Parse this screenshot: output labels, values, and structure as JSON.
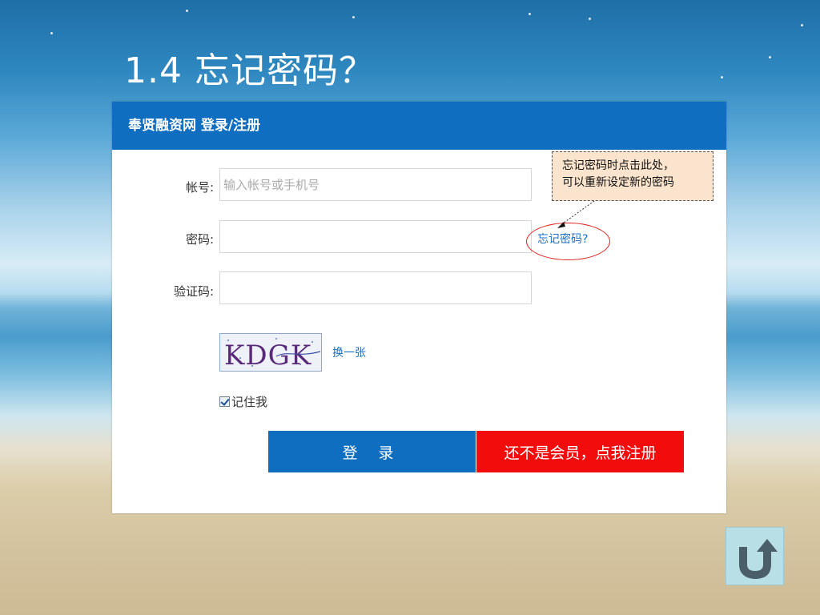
{
  "slide": {
    "title": "1.4 忘记密码？"
  },
  "site_header": {
    "title": "奉贤融资网  登录/注册"
  },
  "form": {
    "account_label": "帐号:",
    "account_placeholder": "输入帐号或手机号",
    "password_label": "密码:",
    "captcha_label": "验证码:",
    "captcha_text": "KDGK",
    "refresh_label": "换一张",
    "remember_label": "记住我",
    "forgot_link": "忘记密码?",
    "login_button": "登 录",
    "register_button": "还不是会员，点我注册"
  },
  "callout": {
    "line1": "忘记密码时点击此处，",
    "line2": "可以重新设定新的密码"
  },
  "icons": {
    "return": "return-arrow-icon",
    "remember_checkbox_checked": true
  },
  "colors": {
    "header_blue": "#0f6ebf",
    "register_red": "#f20c0c",
    "link_blue": "#1a6fc4",
    "highlight_ellipse": "#e02020"
  }
}
